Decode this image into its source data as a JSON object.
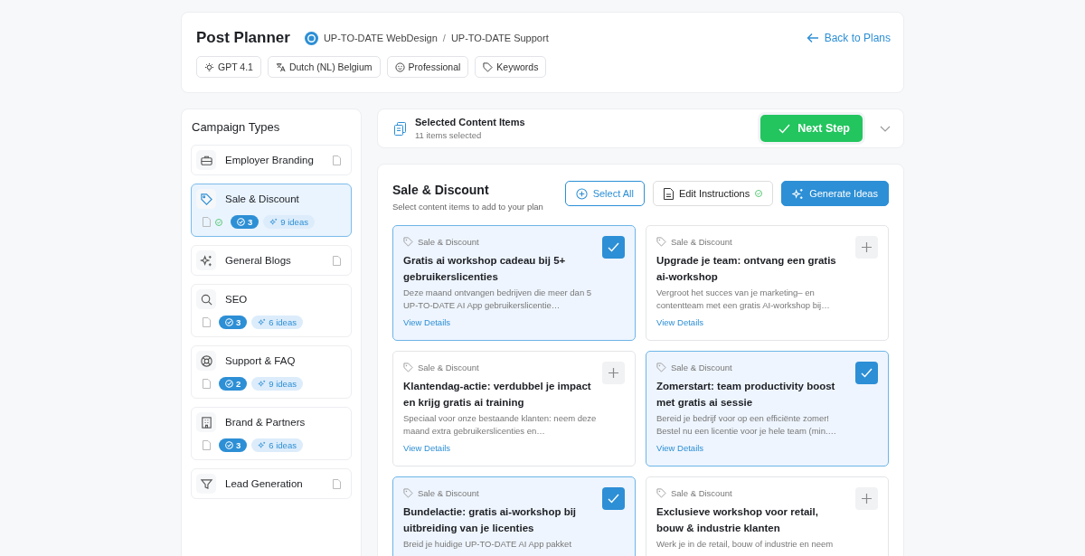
{
  "header": {
    "title": "Post Planner",
    "breadcrumb": [
      "UP-TO-DATE WebDesign",
      "UP-TO-DATE Support"
    ],
    "breadcrumb_separator": "/",
    "back_link": "Back to Plans",
    "chips": [
      "GPT 4.1",
      "Dutch (NL) Belgium",
      "Professional",
      "Keywords"
    ]
  },
  "sidebar": {
    "title": "Campaign Types",
    "items": [
      {
        "name": "Employer Branding",
        "selected": false
      },
      {
        "name": "Sale & Discount",
        "selected": true,
        "instructions_set": true,
        "done_count": "3",
        "ideas": "9 ideas"
      },
      {
        "name": "General Blogs",
        "selected": false
      },
      {
        "name": "SEO",
        "selected": false,
        "instructions_set": false,
        "done_count": "3",
        "ideas": "6 ideas"
      },
      {
        "name": "Support & FAQ",
        "selected": false,
        "instructions_set": false,
        "done_count": "2",
        "ideas": "9 ideas"
      },
      {
        "name": "Brand & Partners",
        "selected": false,
        "instructions_set": false,
        "done_count": "3",
        "ideas": "6 ideas"
      },
      {
        "name": "Lead Generation",
        "selected": false
      }
    ]
  },
  "selection_bar": {
    "title": "Selected Content Items",
    "subtitle": "11 items selected",
    "next_button": "Next Step"
  },
  "content": {
    "title": "Sale & Discount",
    "subtitle": "Select content items to add to your plan",
    "select_all": "Select All",
    "edit_instructions": "Edit Instructions",
    "instructions_set": true,
    "generate": "Generate Ideas",
    "cards": [
      {
        "tag": "Sale & Discount",
        "title": "Gratis ai workshop cadeau bij 5+ gebruikerslicenties",
        "description": "Deze maand ontvangen bedrijven die meer dan 5 UP-TO-DATE AI App gebruikerslicentie…",
        "link": "View Details",
        "selected": true
      },
      {
        "tag": "Sale & Discount",
        "title": "Upgrade je team: ontvang een gratis ai-workshop",
        "description": "Vergroot het succes van je marketing– en contentteam met een gratis AI-workshop bij…",
        "link": "View Details",
        "selected": false
      },
      {
        "tag": "Sale & Discount",
        "title": "Klantendag-actie: verdubbel je impact en krijg gratis ai training",
        "description": "Speciaal voor onze bestaande klanten: neem deze maand extra gebruikerslicenties en…",
        "link": "View Details",
        "selected": false
      },
      {
        "tag": "Sale & Discount",
        "title": "Zomerstart: team productivity boost met gratis ai sessie",
        "description": "Bereid je bedrijf voor op een efficiënte zomer! Bestel nu een licentie voor je hele team (min.…",
        "link": "View Details",
        "selected": true
      },
      {
        "tag": "Sale & Discount",
        "title": "Bundelactie: gratis ai-workshop bij uitbreiding van je licenties",
        "description": "Breid je huidige UP-TO-DATE AI App pakket",
        "selected": true
      },
      {
        "tag": "Sale & Discount",
        "title": "Exclusieve workshop voor retail, bouw & industrie klanten",
        "description": "Werk je in de retail, bouw of industrie en neem",
        "selected": false
      }
    ]
  }
}
